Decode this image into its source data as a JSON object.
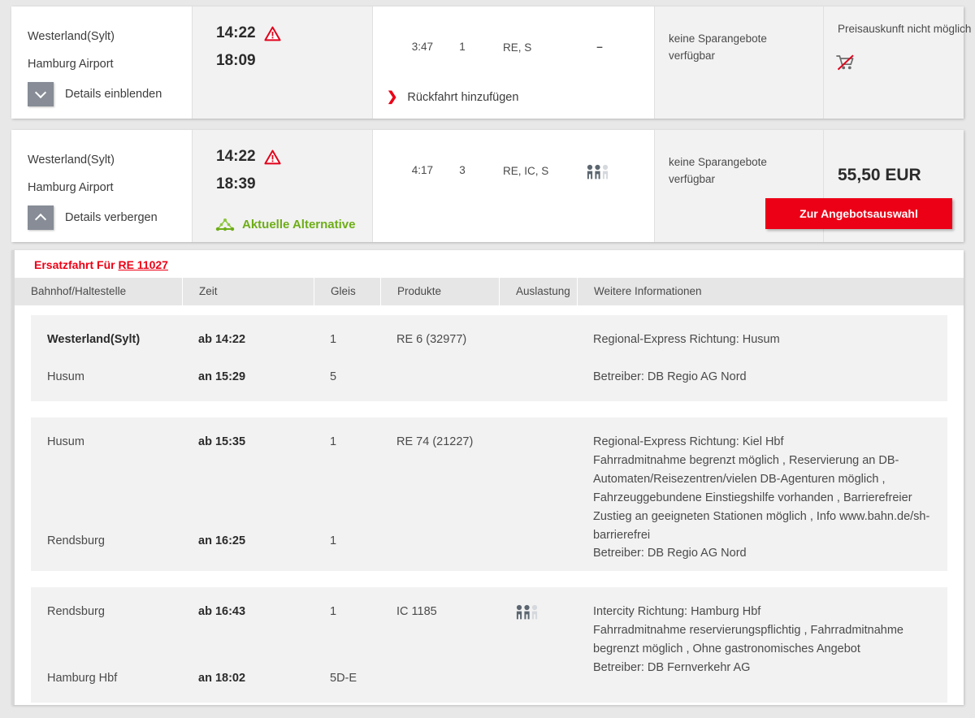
{
  "connections": [
    {
      "departure_station": "Westerland(Sylt)",
      "arrival_station": "Hamburg Airport",
      "departure_time": "14:22",
      "arrival_time": "18:09",
      "warning_icon": "warning-triangle-icon",
      "toggle_label": "Details einblenden",
      "toggle_icon": "chevron-down-icon",
      "duration": "3:47",
      "changes": "1",
      "products": "RE, S",
      "occupancy": "–",
      "return_link_label": "Rückfahrt hinzufügen",
      "return_link_icon": "chevron-right-icon",
      "saver_text": "keine Sparangebote verfügbar",
      "price_note": "Preisauskunft nicht möglich",
      "cart_icon": "cart-unavailable-icon"
    },
    {
      "departure_station": "Westerland(Sylt)",
      "arrival_station": "Hamburg Airport",
      "departure_time": "14:22",
      "arrival_time": "18:39",
      "warning_icon": "warning-triangle-icon",
      "toggle_label": "Details verbergen",
      "toggle_icon": "chevron-up-icon",
      "alternative_label": "Aktuelle Alternative",
      "alternative_icon": "route-network-icon",
      "duration": "4:17",
      "changes": "3",
      "products": "RE, IC, S",
      "occupancy_icon": "occupancy-three-persons-icon",
      "saver_text": "keine Sparangebote verfügbar",
      "price": "55,50 EUR",
      "offer_button_label": "Zur Angebotsauswahl"
    }
  ],
  "detail": {
    "replacement_prefix": "Ersatzfahrt Für ",
    "replacement_train": "RE 11027",
    "columns": {
      "station": "Bahnhof/Haltestelle",
      "time": "Zeit",
      "track": "Gleis",
      "products": "Produkte",
      "occupancy": "Auslastung",
      "info": "Weitere Informationen"
    },
    "legs": [
      {
        "from_station": "Westerland(Sylt)",
        "to_station": "Husum",
        "dep_time": "ab 14:22",
        "arr_time": "an 15:29",
        "dep_track": "1",
        "arr_track": "5",
        "product": "RE 6 (32977)",
        "occupancy_icon": "",
        "info_lines": [
          "Regional-Express Richtung: Husum",
          "Betreiber: DB Regio AG Nord"
        ],
        "info_gap_after": 1
      },
      {
        "from_station": "Husum",
        "to_station": "Rendsburg",
        "dep_time": "ab 15:35",
        "arr_time": "an 16:25",
        "dep_track": "1",
        "arr_track": "1",
        "product": "RE 74 (21227)",
        "occupancy_icon": "",
        "info_lines": [
          "Regional-Express Richtung: Kiel Hbf",
          "Fahrradmitnahme begrenzt möglich , Reservierung an DB-Automaten/Reisezentren/vielen DB-Agenturen möglich , Fahrzeuggebundene Einstiegshilfe vorhanden , Barrierefreier Zustieg an geeigneten Stationen möglich , Info www.bahn.de/sh-barrierefrei",
          "Betreiber: DB Regio AG Nord"
        ]
      },
      {
        "from_station": "Rendsburg",
        "to_station": "Hamburg Hbf",
        "dep_time": "ab 16:43",
        "arr_time": "an 18:02",
        "dep_track": "1",
        "arr_track": "5D-E",
        "product": "IC 1185",
        "occupancy_icon": "occupancy-three-persons-icon",
        "info_lines": [
          "Intercity Richtung: Hamburg Hbf",
          "Fahrradmitnahme reservierungspflichtig , Fahrradmitnahme begrenzt möglich , Ohne gastronomisches Angebot",
          "Betreiber: DB Fernverkehr AG"
        ]
      }
    ]
  },
  "colors": {
    "brand_red": "#ec0016",
    "alternative_green": "#6ead18",
    "toggle_gray": "#878c96",
    "row_gray": "#f2f2f2",
    "header_gray": "#e6e6e6"
  }
}
